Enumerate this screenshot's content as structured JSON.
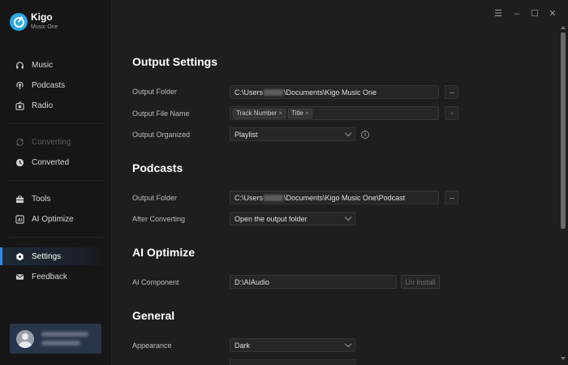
{
  "app": {
    "name": "Kigo",
    "subtitle": "Music One"
  },
  "sidebar": {
    "items": [
      {
        "label": "Music",
        "icon": "headphones-icon"
      },
      {
        "label": "Podcasts",
        "icon": "podcast-icon"
      },
      {
        "label": "Radio",
        "icon": "radio-icon"
      },
      {
        "label": "Converting",
        "icon": "converting-icon",
        "disabled": true
      },
      {
        "label": "Converted",
        "icon": "clock-icon"
      },
      {
        "label": "Tools",
        "icon": "toolbox-icon"
      },
      {
        "label": "AI Optimize",
        "icon": "ai-icon"
      },
      {
        "label": "Settings",
        "icon": "gear-icon",
        "active": true
      },
      {
        "label": "Feedback",
        "icon": "mail-icon"
      }
    ]
  },
  "window_controls": {
    "menu": "☰",
    "minimize": "–",
    "maximize": "☐",
    "close": "✕"
  },
  "output_settings": {
    "title": "Output Settings",
    "output_folder_label": "Output Folder",
    "output_folder_prefix": "C:\\Users",
    "output_folder_suffix": "\\Documents\\Kigo Music One",
    "output_file_name_label": "Output File Name",
    "file_name_tags": [
      "Track Number",
      "Title"
    ],
    "output_organized_label": "Output Organized",
    "output_organized_value": "Playlist"
  },
  "podcasts": {
    "title": "Podcasts",
    "output_folder_label": "Output Folder",
    "output_folder_prefix": "C:\\Users",
    "output_folder_suffix": "\\Documents\\Kigo Music One\\Podcast",
    "after_converting_label": "After Converting",
    "after_converting_value": "Open the output folder"
  },
  "ai_optimize": {
    "title": "AI Optimize",
    "component_label": "AI Component",
    "component_path": "D:\\AIAudio",
    "uninstall_label": "Un Install"
  },
  "general": {
    "title": "General",
    "appearance_label": "Appearance",
    "appearance_value": "Dark"
  },
  "ui": {
    "browse_label": "···",
    "add_label": "+",
    "info_label": "i",
    "tag_remove": "×"
  },
  "colors": {
    "accent": "#2e8cf0",
    "background": "#1e1e1e",
    "sidebar": "#161617"
  }
}
